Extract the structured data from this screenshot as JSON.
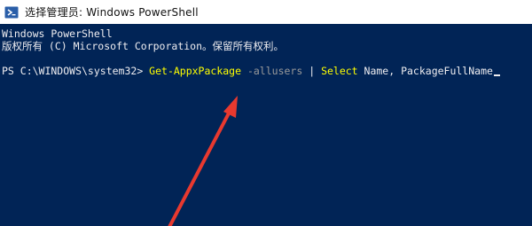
{
  "window": {
    "title": "选择管理员: Windows PowerShell",
    "icon": "powershell-icon"
  },
  "console": {
    "banner_line1": "Windows PowerShell",
    "banner_line2": "版权所有 (C) Microsoft Corporation。保留所有权利。",
    "prompt": "PS C:\\WINDOWS\\system32> ",
    "command": "Get-AppxPackage",
    "parameter": " -allusers",
    "pipe": " | ",
    "command2": "Select",
    "arguments": " Name, PackageFullName",
    "colors": {
      "background": "#012456",
      "text": "#EEEDF0",
      "command": "#FFFF00",
      "parameter": "#9A9A9A"
    }
  },
  "annotation": {
    "icon": "red-arrow-icon",
    "color": "#E8392F"
  }
}
